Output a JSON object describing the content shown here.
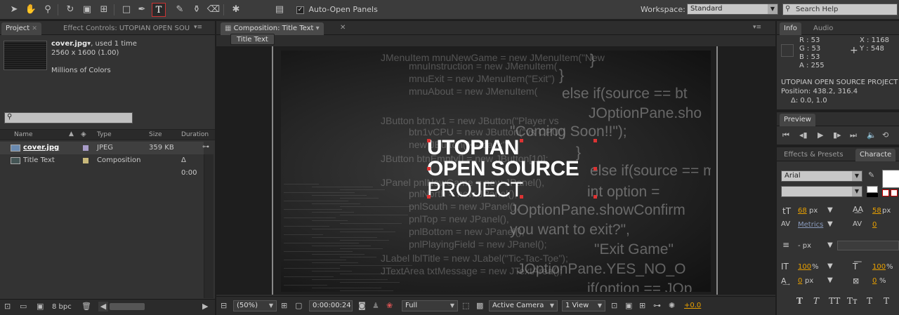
{
  "toolbar": {
    "auto_open_panels": "Auto-Open Panels",
    "workspace_label": "Workspace:",
    "workspace_value": "Standard",
    "search_placeholder": "Search Help",
    "tools": [
      "selection-tool",
      "hand-tool",
      "zoom-tool",
      "rotation-tool",
      "camera-tool",
      "pan-behind-tool",
      "rectangle-tool",
      "pen-tool",
      "text-tool",
      "brush-tool",
      "clone-stamp-tool",
      "eraser-tool",
      "puppet-tool"
    ]
  },
  "project": {
    "tab_project": "Project",
    "tab_effect_controls": "Effect Controls: UTOPIAN OPEN SOU",
    "file_name": "cover.jpg",
    "used": ", used 1 time",
    "dimensions": "2560 x 1600 (1.00)",
    "colors": "Millions of Colors",
    "search_placeholder": "",
    "columns": {
      "name": "Name",
      "type": "Type",
      "size": "Size",
      "duration": "Duration"
    },
    "items": [
      {
        "name": "cover.jpg",
        "type": "JPEG",
        "size": "359 KB",
        "duration": "",
        "color": "#a89cc8"
      },
      {
        "name": "Title Text",
        "type": "Composition",
        "size": "",
        "duration": "Δ 0:00",
        "color": "#c8b87a"
      }
    ],
    "bpc": "8 bpc"
  },
  "composition": {
    "tab": "Composition: Title Text",
    "subtab": "Title Text",
    "title_lines": [
      "UTOPIAN",
      "OPEN SOURCE",
      "PROJECT"
    ],
    "code_bg": [
      "JMenuItem     mnuNewGame = new JMenuItem(\"New",
      "                 mnuInstruction = new JMenuItem(",
      "                 mnuExit = new JMenuItem(\"Exit\")",
      "                 mnuAbout = new JMenuItem(",
      "JButton    btn1v1 = new JButton(\"Player vs",
      "                 btn1vCPU = new JButton(\"vs CPU\")",
      "                 new JButton(\"<--back\");",
      "JButton btnEmpty[] = new JButton[10];",
      "JPanel    pnlNewGame = new JPanel(),",
      "                 pnlNorth = new JPanel(),",
      "                 pnlSouth = new JPanel(),",
      "                 pnlTop = new JPanel(),",
      "                 pnlBottom = new JPanel(),",
      "                 pnlPlayingField = new JPanel();",
      "JLabel lblTitle = new JLabel(\"Tic-Tac-Toe\");",
      "JTextArea txtMessage = new JTextArea();"
    ],
    "code_right": [
      "}",
      "}",
      "else if(source == bt",
      "JOptionPane.sho",
      "\"Coming Soon!!\");",
      "}",
      "else if(source == m",
      "int option =",
      "JOptionPane.showConfirm",
      "you want to exit?\",",
      "\"Exit Game\"",
      "JOptionPane.YES_NO_O",
      "if(option == JOp"
    ],
    "zoom": "(50%)",
    "timecode": "0:00:00:24",
    "resolution": "Full",
    "camera": "Active Camera",
    "view": "1 View",
    "exposure": "+0.0"
  },
  "info": {
    "tab_info": "Info",
    "tab_audio": "Audio",
    "r": "R : 53",
    "g": "G : 53",
    "b": "B : 53",
    "a": "A :  255",
    "x": "X : 1168",
    "y": "Y : 548",
    "layer": "UTOPIAN OPEN SOURCE PROJECT",
    "position": "Position: 438.2, 316.4",
    "delta": "Δ: 0.0, 1.0"
  },
  "preview": {
    "tab": "Preview"
  },
  "character": {
    "tab_effects": "Effects & Presets",
    "tab_character": "Characte",
    "font": "Arial",
    "font_size": "68",
    "leading": "58",
    "kerning": "Metrics",
    "tracking": "0",
    "stroke": "- px",
    "vscale": "100",
    "hscale": "100",
    "baseline": "0",
    "tsume": "0",
    "unit_px": "px",
    "unit_pct": "%",
    "style_buttons": [
      "T",
      "T",
      "TT",
      "Tт",
      "T",
      "T"
    ]
  }
}
